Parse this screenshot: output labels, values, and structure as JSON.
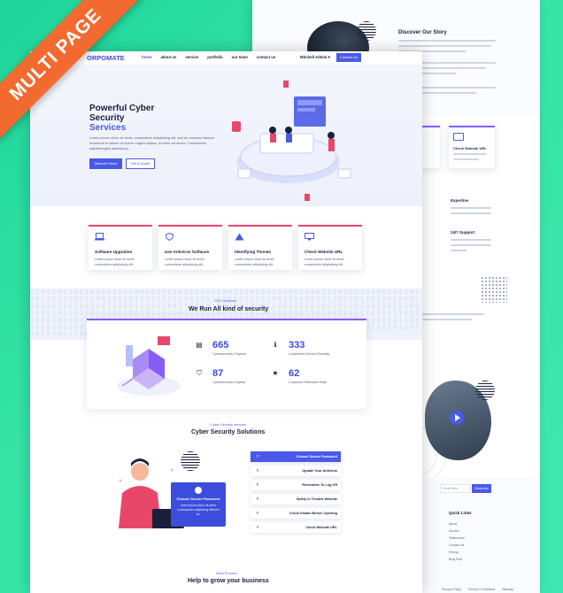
{
  "ribbon": {
    "label": "MULTI PAGE"
  },
  "back": {
    "story_title": "Discover Our Story",
    "cards": [
      {
        "title": "Check Website URL"
      }
    ],
    "small_titles": [
      "Expertise",
      "24/7 Support"
    ],
    "newsletter": {
      "placeholder": "Email Here",
      "button": "Subscribe"
    },
    "quick_links_title": "Quick Links",
    "quick_links": [
      "About",
      "Service",
      "Testimonial",
      "Contact Us",
      "Pricing",
      "Blog Post"
    ],
    "bottom_links": [
      "Privacy Policy",
      "Terms & Conditions",
      "Sitemap"
    ]
  },
  "nav": {
    "logo": "ORPOMATE",
    "items": [
      "home",
      "about us",
      "service",
      "portfolio",
      "our team",
      "contact us"
    ],
    "active": "home",
    "admin": "Mitchell Admin ▾",
    "contact_button": "Contact Us"
  },
  "hero": {
    "title": "Powerful Cyber Security",
    "subtitle": "Services",
    "text": "Lorem ipsum dolor sit amet, consectetur adipisicing elit, sed do eiusmod tempor incididunt ut labore et dolore magna aliqua. Ut enim ad minim. Consectetur adipisicingelit adipisicing.",
    "discover_button": "Discover More",
    "quote_button": "Get a Quote"
  },
  "services": [
    {
      "title": "Software Upgration",
      "desc": "Lorem ipsum dolor sit amet, consectetur adipisicing elit.",
      "icon": "laptop-icon"
    },
    {
      "title": "Use Antivirus Software",
      "desc": "Lorem ipsum dolor sit amet, consectetur adipisicing elit.",
      "icon": "shield-icon"
    },
    {
      "title": "Identifying Threats",
      "desc": "Lorem ipsum dolor sit amet, consectetur adipisicing elit.",
      "icon": "warning-icon"
    },
    {
      "title": "Check Website URL",
      "desc": "Lorem ipsum dolor sit amet, consectetur adipisicing elit.",
      "icon": "monitor-icon"
    }
  ],
  "band": {
    "label": "Our Company",
    "title": "We Run All kind of security",
    "pattern": "0101100110100101101001011010011010100110010110100101011001011010010110100110101001100101101001010110010110100101101001101010011001011010010101100101101001011010011010100110010110100101011001011010010110100110101001100101101001010110010110100101101001101010011001011010010101100101101001011010011010100110010110100101011001011010010110100110101001100101101001010110010110100101101001101010011001011010010101100101101001011010011010100110010110100101011001011010010110100110101001100101"
  },
  "stats": [
    {
      "value": "665",
      "label": "Cybersecurity Projects",
      "icon": "server-icon",
      "glyph": "▤"
    },
    {
      "value": "333",
      "label": "Customers Served Globally",
      "icon": "info-icon",
      "glyph": "ℹ"
    },
    {
      "value": "87",
      "label": "Cybersecurity Experts",
      "icon": "shield-icon",
      "glyph": "⛉"
    },
    {
      "value": "62",
      "label": "Customer Retention Rate",
      "icon": "star-icon",
      "glyph": "★"
    }
  ],
  "solutions": {
    "label": "Cyber Security services",
    "title": "Cyber Security Solutions",
    "items": [
      "Choose Secure Password",
      "Update Your Antivirus",
      "Remember To Log Off",
      "Safety In Trusted Website",
      "Check Emails Before Opening",
      "Check Website URL"
    ],
    "active_index": 0,
    "card": {
      "title": "Choose Secure Password",
      "text": "lorem ipsum dolor sit amet consequatur adipiscing elitused do."
    }
  },
  "grow": {
    "label": "Work Process",
    "title": "Help to grow your business"
  }
}
